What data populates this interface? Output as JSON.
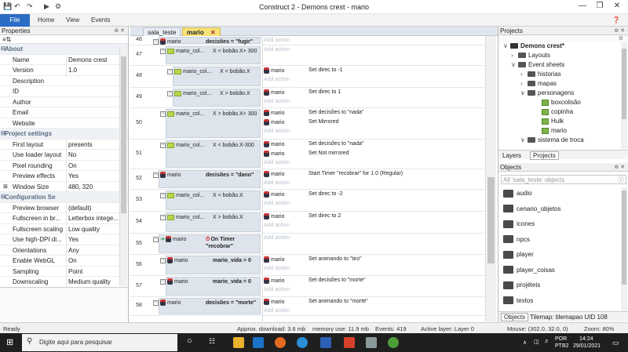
{
  "window": {
    "title": "Construct 2 - Demons crest - mario",
    "min": "—",
    "max": "❐",
    "close": "✕"
  },
  "ribbon": {
    "file": "File",
    "home": "Home",
    "view": "View",
    "events": "Events"
  },
  "properties": {
    "title": "Properties",
    "sections": [
      {
        "label": "About",
        "rows": [
          {
            "k": "Name",
            "v": "Demons crest"
          },
          {
            "k": "Version",
            "v": "1.0"
          },
          {
            "k": "Description",
            "v": ""
          },
          {
            "k": "ID",
            "v": ""
          },
          {
            "k": "Author",
            "v": ""
          },
          {
            "k": "Email",
            "v": ""
          },
          {
            "k": "Website",
            "v": ""
          }
        ]
      },
      {
        "label": "Project settings",
        "rows": [
          {
            "k": "First layout",
            "v": "presents"
          },
          {
            "k": "Use loader layout",
            "v": "No"
          },
          {
            "k": "Pixel rounding",
            "v": "On"
          },
          {
            "k": "Preview effects",
            "v": "Yes"
          },
          {
            "k": "Window Size",
            "v": "480, 320"
          }
        ]
      },
      {
        "label": "Configuration Settings",
        "rows": [
          {
            "k": "Preview browser",
            "v": "(default)"
          },
          {
            "k": "Fullscreen in br...",
            "v": "Letterbox intege..."
          },
          {
            "k": "Fullscreen scaling",
            "v": "Low quality"
          },
          {
            "k": "Use high-DPI di...",
            "v": "Yes"
          },
          {
            "k": "Orientations",
            "v": "Any"
          },
          {
            "k": "Enable WebGL",
            "v": "On"
          },
          {
            "k": "Sampling",
            "v": "Point"
          },
          {
            "k": "Downscaling",
            "v": "Medium quality"
          }
        ]
      }
    ]
  },
  "doc_tabs": [
    {
      "label": "sala_teste"
    },
    {
      "label": "mario"
    }
  ],
  "events": [
    {
      "num": "46",
      "obj": "mario",
      "cond": "decisões = \"fugir\"",
      "actions": [],
      "add": "Add action"
    },
    {
      "num": "47",
      "obj": "mario_col...",
      "cond": "X < bobão.X+ 300",
      "actions": [],
      "add": "Add action"
    },
    {
      "num": "48",
      "obj": "mario_col...",
      "cond": "X < bobão.X",
      "actions": [
        {
          "o": "mario",
          "a": "Set direc to -1"
        }
      ],
      "add": "Add action"
    },
    {
      "num": "49",
      "obj": "mario_col...",
      "cond": "X > bobão.X",
      "actions": [
        {
          "o": "mario",
          "a": "Set direc to 1"
        }
      ],
      "add": "Add action"
    },
    {
      "num": "50",
      "obj": "mario_col...",
      "cond": "X > bobão.X+ 300",
      "actions": [
        {
          "o": "mario",
          "a": "Set decisões to \"nada\""
        },
        {
          "o": "mario",
          "a": "Set Mirrored"
        }
      ],
      "add": "Add action"
    },
    {
      "num": "51",
      "obj": "mario_col...",
      "cond": "X < bobão.X-300",
      "actions": [
        {
          "o": "mario",
          "a": "Set decisões to \"nada\""
        },
        {
          "o": "mario",
          "a": "Set Not mirrored"
        }
      ],
      "add": "Add action"
    },
    {
      "num": "52",
      "obj": "mario",
      "cond": "decisões = \"dano\"",
      "actions": [
        {
          "o": "mario",
          "a": "Start Timer \"recobrar\" for 1.0 (Regular)"
        }
      ],
      "add": "Add action"
    },
    {
      "num": "53",
      "obj": "mario_col...",
      "cond": "X < bobão.X",
      "actions": [
        {
          "o": "mario",
          "a": "Set direc to -2"
        }
      ],
      "add": "Add action"
    },
    {
      "num": "54",
      "obj": "mario_col...",
      "cond": "X > bobão.X",
      "actions": [
        {
          "o": "mario",
          "a": "Set direc to 2"
        }
      ],
      "add": "Add action"
    },
    {
      "num": "55",
      "obj": "mario",
      "cond": "On Timer \"recobrar\"",
      "actions": [],
      "add": "Add action"
    },
    {
      "num": "56",
      "obj": "mario",
      "cond": "mario_vida > 0",
      "actions": [
        {
          "o": "mario",
          "a": "Set animando to \"tiro\""
        }
      ],
      "add": "Add action"
    },
    {
      "num": "57",
      "obj": "mario",
      "cond": "mario_vida = 0",
      "actions": [
        {
          "o": "mario",
          "a": "Set decisões to \"morte\""
        }
      ],
      "add": "Add action"
    },
    {
      "num": "58",
      "obj": "mario",
      "cond": "decisões = \"morte\"",
      "actions": [
        {
          "o": "mario",
          "a": "Set animando to \"morte\""
        }
      ],
      "add": "Add action"
    }
  ],
  "projects": {
    "title": "Projects",
    "tree": [
      "Demons crest*",
      "Layouts",
      "Event sheets",
      "historias",
      "mapas",
      "personagens",
      "boxcolisão",
      "copinha",
      "Hulk",
      "mario",
      "sistema de troca"
    ],
    "tabs": [
      "Layers",
      "Projects"
    ]
  },
  "objects": {
    "title": "Objects",
    "filter_placeholder": "All 'sala_teste' objects",
    "items": [
      "audio",
      "cenario_objetos",
      "icones",
      "npcs",
      "player",
      "player_coisas",
      "projéteis",
      "textos"
    ],
    "tabs": [
      "Objects",
      "Tilemap: tilemapao UID 108"
    ]
  },
  "status": {
    "ready": "Ready",
    "download": "Approx. download: 3.6 mb",
    "memory": "memory use: 11.9 mb",
    "events": "Events: 419",
    "layer": "Active layer: Layer 0",
    "mouse": "Mouse: (302.0, 32.0, 0)",
    "zoom": "Zoom: 80%"
  },
  "taskbar": {
    "search_placeholder": "Digite aqui para pesquisar",
    "lang": "POR",
    "kbd": "PTB2",
    "time": "14:24",
    "date": "29/01/2021"
  },
  "colors": {
    "accent": "#2b6cc4",
    "tab_active": "#f7e37a",
    "taskbar": "#1f1f1f"
  }
}
